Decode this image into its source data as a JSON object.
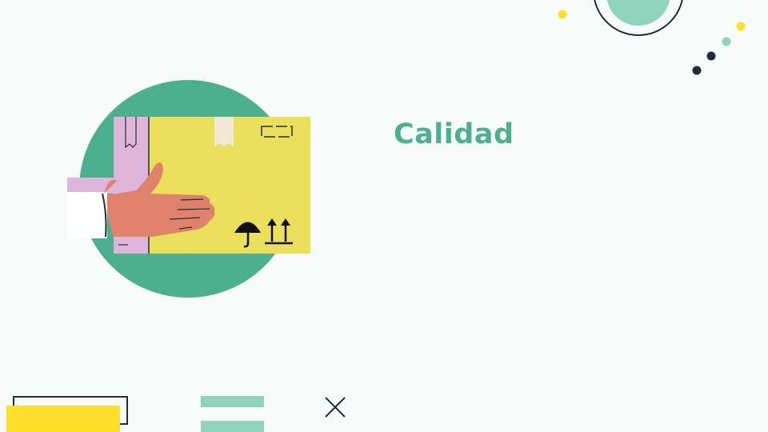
{
  "slide": {
    "title": "Calidad"
  },
  "colors": {
    "background": "#f7fcfb",
    "accent_green": "#4cb08f",
    "mint": "#8fd3bc",
    "yellow": "#ffdf2b",
    "box_yellow": "#ebe05c",
    "tape_pink": "#dfb5dc",
    "skin": "#e0826b",
    "dark": "#1f2d37"
  },
  "icons": [
    "package-box-icon",
    "umbrella-icon",
    "this-side-up-arrows-icon"
  ]
}
